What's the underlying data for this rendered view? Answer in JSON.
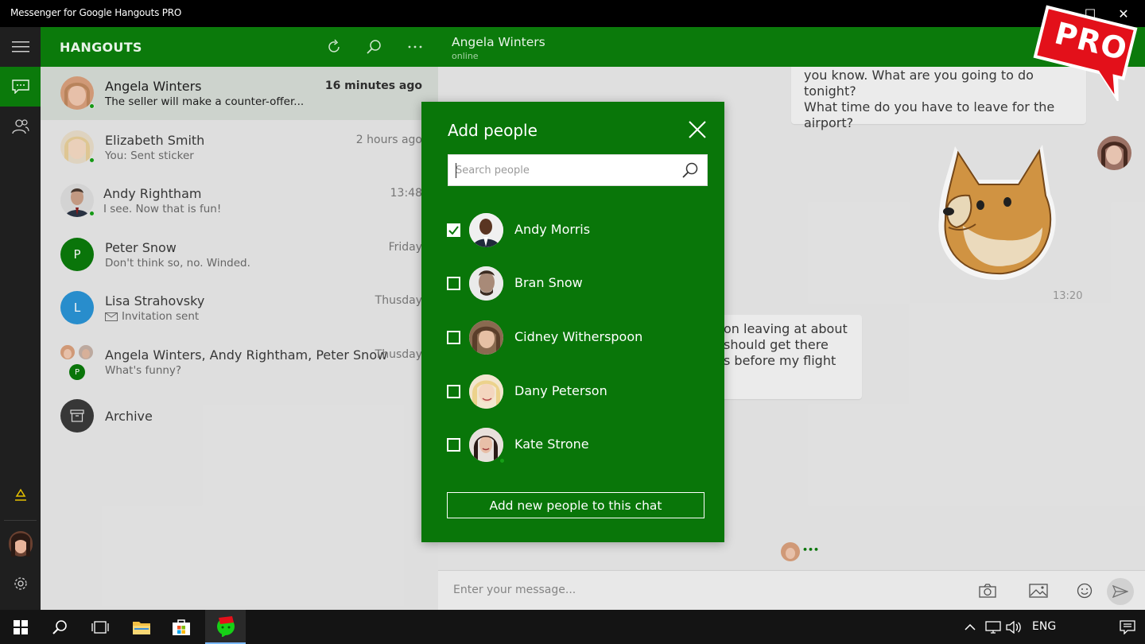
{
  "window": {
    "title": "Messenger for Google Hangouts PRO",
    "minimize": "—",
    "maximize": "☐",
    "close": "✕"
  },
  "badge": {
    "text": "PRO"
  },
  "list": {
    "header_title": "HANGOUTS",
    "conversations": [
      {
        "name": "Angela Winters",
        "message": "The seller will make a counter-offer...",
        "time": "16 minutes ago",
        "online": true,
        "selected": true
      },
      {
        "name": "Elizabeth Smith",
        "message": "You: Sent sticker",
        "time": "2 hours ago",
        "online": true
      },
      {
        "name": "Andy Rightham",
        "message": "I see. Now that is fun!",
        "time": "13:48",
        "online": true
      },
      {
        "name": "Peter Snow",
        "message": "Don't think so, no. Winded.",
        "time": "Friday",
        "avatar_letter": "P",
        "avatar_color": "#0b7a0b"
      },
      {
        "name": "Lisa Strahovsky",
        "message": "Invitation sent",
        "time": "Thusday",
        "avatar_letter": "L",
        "avatar_color": "#2a93d5"
      },
      {
        "name": "Angela Winters, Andy Rightham, Peter Snow",
        "message": "What's funny?",
        "time": "Thusday",
        "group_letter": "P"
      }
    ],
    "archive_label": "Archive"
  },
  "chat": {
    "contact_name": "Angela Winters",
    "contact_status": "online",
    "bubble_top": [
      "you know. What are you going to do tonight?",
      "What time do you have to leave for the",
      "airport?"
    ],
    "sticker_time": "13:20",
    "bubble_mid": [
      "on leaving at about",
      "should get there",
      "s before my flight"
    ],
    "typing": "•••",
    "composer_placeholder": "Enter your message..."
  },
  "dialog": {
    "title": "Add people",
    "search_placeholder": "Search people",
    "people": [
      {
        "name": "Andy Morris",
        "checked": true
      },
      {
        "name": "Bran Snow",
        "checked": false
      },
      {
        "name": "Cidney Witherspoon",
        "checked": false
      },
      {
        "name": "Dany Peterson",
        "checked": false
      },
      {
        "name": "Kate Strone",
        "checked": false
      }
    ],
    "add_button": "Add new people to this chat"
  },
  "taskbar": {
    "language": "ENG"
  },
  "colors": {
    "accent_green": "#0b7a0b",
    "dialog_green": "#097609",
    "online_dot": "#16a016",
    "pro_red": "#e3101a"
  }
}
